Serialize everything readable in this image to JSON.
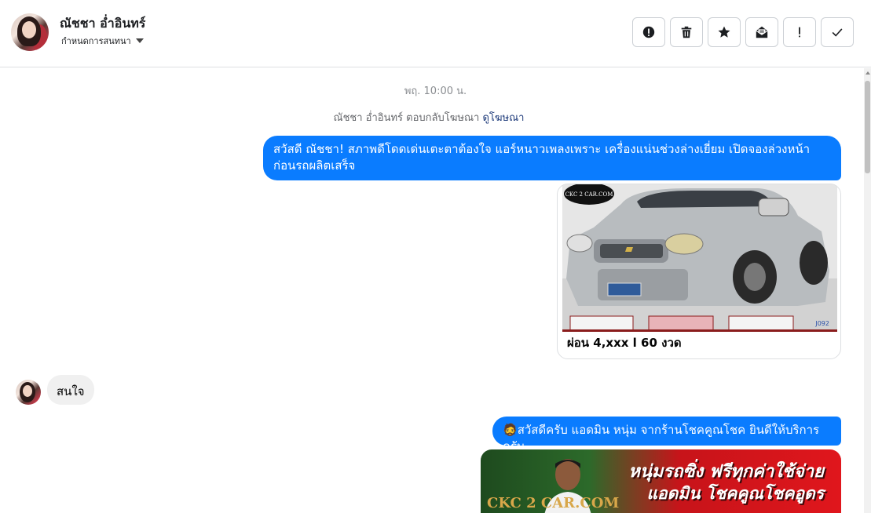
{
  "header": {
    "contact_name": "ณัชชา อ่ำอินทร์",
    "assign_label": "กำหนดการสนทนา",
    "actions": [
      {
        "name": "report-button",
        "icon": "exclamation-circle-icon"
      },
      {
        "name": "delete-button",
        "icon": "trash-icon"
      },
      {
        "name": "star-button",
        "icon": "star-icon"
      },
      {
        "name": "mark-unread-button",
        "icon": "envelope-open-icon"
      },
      {
        "name": "spam-button",
        "icon": "exclamation-icon"
      },
      {
        "name": "done-button",
        "icon": "check-icon"
      }
    ]
  },
  "conversation": {
    "timestamp": "พฤ. 10:00 น.",
    "reply_note": "ณัชชา อ่ำอินทร์ ตอบกลับโฆษณา",
    "reply_note_link": "ดูโฆษณา",
    "messages": [
      {
        "from": "page",
        "text": "สวัสดี ณัชชา! สภาพดีโดดเด่นเตะตาต้องใจ แอร์หนาวเพลงเพราะ เครื่องแน่นช่วงล่างเยี่ยม เปิดจองล่วงหน้าก่อนรถผลิตเสร็จ"
      },
      {
        "from": "page",
        "type": "card",
        "image_logo": "CKC 2 CAR.COM",
        "image_code": "J092",
        "caption": "ผ่อน 4,xxx l 60 งวด"
      },
      {
        "from": "user",
        "text": "สนใจ"
      },
      {
        "from": "page",
        "emoji": "🧔",
        "text": "สวัสดีครับ แอดมิน หนุ่ม จากร้านโชคคูณโชค ยินดีให้บริการครับ"
      },
      {
        "from": "page",
        "type": "image",
        "banner_line1": "หนุ่มรถซิ่ง ฟรีทุกค่าใช้จ่าย",
        "banner_line2": "แอดมิน โชคคูณโชคอูดร",
        "banner_logo": "CKC 2 CAR.COM"
      }
    ]
  },
  "colors": {
    "accent": "#0a7cff",
    "incoming_bubble": "#f0f0f0",
    "muted_text": "#8a8d91"
  }
}
